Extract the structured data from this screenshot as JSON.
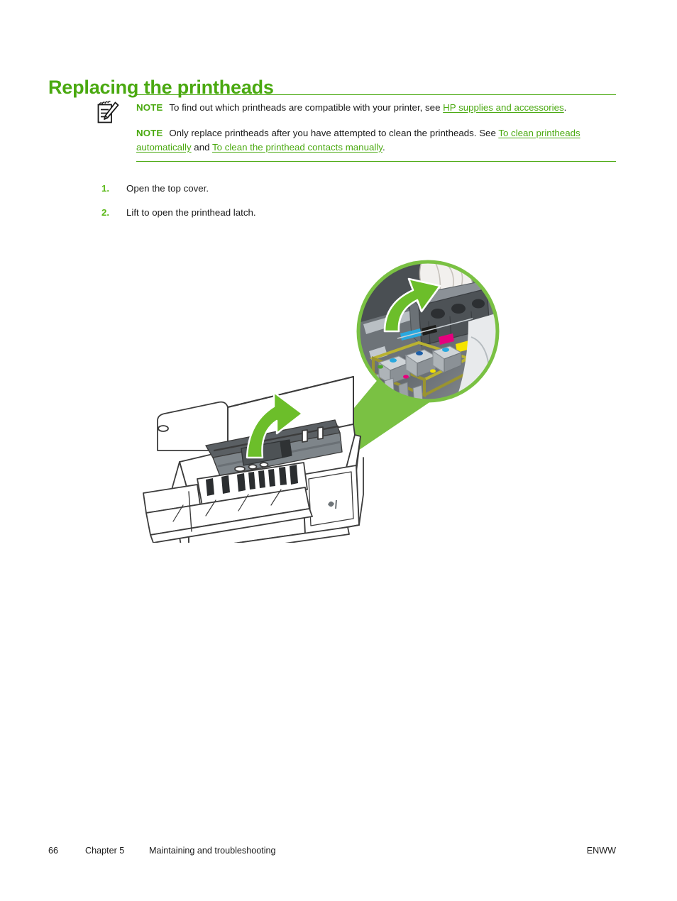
{
  "document": {
    "heading": "Replacing the printheads",
    "notes": [
      {
        "label": "NOTE",
        "text_before": "To find out which printheads are compatible with your printer, see ",
        "links": [
          {
            "text": "HP supplies and accessories"
          }
        ],
        "text_after": "."
      },
      {
        "label": "NOTE",
        "text_before": "Only replace printheads after you have attempted to clean the printheads. See ",
        "links": [
          {
            "text": "To clean printheads automatically"
          },
          {
            "text": "To clean the printhead contacts manually"
          }
        ],
        "conjunction": " and ",
        "text_after": "."
      }
    ],
    "steps": [
      {
        "number": "1.",
        "text": "Open the top cover."
      },
      {
        "number": "2.",
        "text": "Lift to open the printhead latch."
      }
    ],
    "figure": {
      "caption_alt": "Line drawing of an HP inkjet printer with its top cover lifted open, and a circular magnified callout showing the printhead latch being lifted by a hand, with cyan, magenta and yellow ink cartridges visible",
      "callout_arrow_label": "lift-direction-arrow"
    },
    "footer": {
      "page_number": "66",
      "chapter": "Chapter 5",
      "section_title": "Maintaining and troubleshooting",
      "locale_code": "ENWW"
    },
    "colors": {
      "heading_green": "#4aa910",
      "link_green": "#4aa910",
      "step_number_green": "#5bb918",
      "rule_green": "#4aa910",
      "callout_green": "#7ac143",
      "body_text": "#1a1a1a"
    }
  }
}
